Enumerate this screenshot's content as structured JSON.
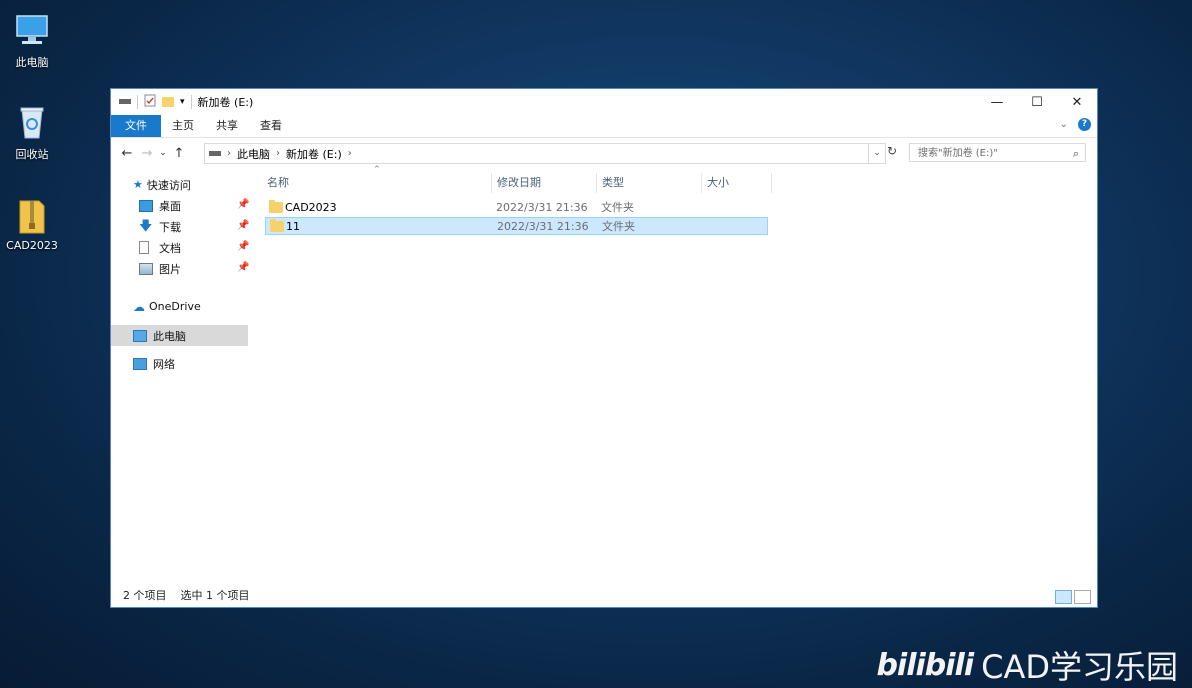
{
  "desktop": {
    "icons": [
      {
        "label": "此电脑",
        "icon": "computer-icon"
      },
      {
        "label": "回收站",
        "icon": "recycle-bin-icon"
      },
      {
        "label": "CAD2023",
        "icon": "zip-archive-icon"
      }
    ]
  },
  "window": {
    "title": "新加卷 (E:)",
    "ribbon_tabs": [
      "文件",
      "主页",
      "共享",
      "查看"
    ],
    "address": {
      "segments": [
        "此电脑",
        "新加卷 (E:)"
      ]
    },
    "search_placeholder": "搜索\"新加卷 (E:)\"",
    "nav": {
      "quick_access": "快速访问",
      "quick_items": [
        {
          "label": "桌面",
          "icon": "desktop-icon"
        },
        {
          "label": "下载",
          "icon": "download-icon"
        },
        {
          "label": "文档",
          "icon": "document-icon"
        },
        {
          "label": "图片",
          "icon": "pictures-icon"
        }
      ],
      "onedrive": "OneDrive",
      "this_pc": "此电脑",
      "network": "网络"
    },
    "columns": [
      "名称",
      "修改日期",
      "类型",
      "大小"
    ],
    "files": [
      {
        "name": "CAD2023",
        "date": "2022/3/31 21:36",
        "type": "文件夹",
        "size": "",
        "selected": false
      },
      {
        "name": "11",
        "date": "2022/3/31 21:36",
        "type": "文件夹",
        "size": "",
        "selected": true
      }
    ],
    "status": {
      "count": "2 个项目",
      "selection": "选中 1 个项目"
    }
  },
  "watermark": {
    "brand": "bilibili",
    "channel": "CAD学习乐园"
  },
  "colors": {
    "accent": "#1979ca",
    "selection": "#cce8ff",
    "folder": "#f7d26a"
  }
}
